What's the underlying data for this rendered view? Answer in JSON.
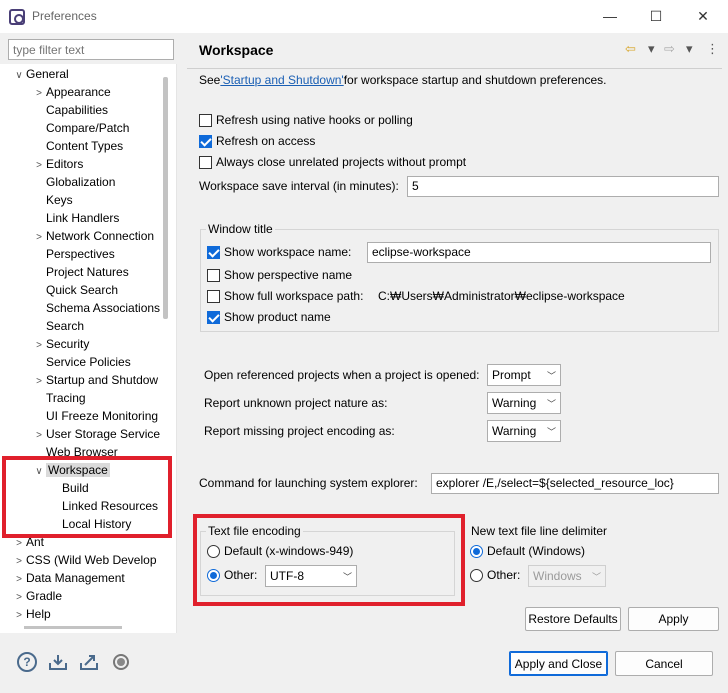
{
  "window": {
    "title": "Preferences",
    "minimize": "—",
    "maximize": "☐",
    "close": "✕"
  },
  "filter": {
    "placeholder": "type filter text"
  },
  "tree": [
    {
      "label": "General",
      "arrow": "∨"
    },
    {
      "label": "Appearance",
      "arrow": ">"
    },
    {
      "label": "Capabilities",
      "arrow": ""
    },
    {
      "label": "Compare/Patch",
      "arrow": ""
    },
    {
      "label": "Content Types",
      "arrow": ""
    },
    {
      "label": "Editors",
      "arrow": ">"
    },
    {
      "label": "Globalization",
      "arrow": ""
    },
    {
      "label": "Keys",
      "arrow": ""
    },
    {
      "label": "Link Handlers",
      "arrow": ""
    },
    {
      "label": "Network Connection",
      "arrow": ">"
    },
    {
      "label": "Perspectives",
      "arrow": ""
    },
    {
      "label": "Project Natures",
      "arrow": ""
    },
    {
      "label": "Quick Search",
      "arrow": ""
    },
    {
      "label": "Schema Associations",
      "arrow": ""
    },
    {
      "label": "Search",
      "arrow": ""
    },
    {
      "label": "Security",
      "arrow": ">"
    },
    {
      "label": "Service Policies",
      "arrow": ""
    },
    {
      "label": "Startup and Shutdow",
      "arrow": ">"
    },
    {
      "label": "Tracing",
      "arrow": ""
    },
    {
      "label": "UI Freeze Monitoring",
      "arrow": ""
    },
    {
      "label": "User Storage Service",
      "arrow": ">"
    },
    {
      "label": "Web Browser",
      "arrow": ""
    },
    {
      "label": "Workspace",
      "arrow": "∨"
    },
    {
      "label": "Build",
      "arrow": ""
    },
    {
      "label": "Linked Resources",
      "arrow": ""
    },
    {
      "label": "Local History",
      "arrow": ""
    },
    {
      "label": "Ant",
      "arrow": ">"
    },
    {
      "label": "CSS (Wild Web Develop",
      "arrow": ">"
    },
    {
      "label": "Data Management",
      "arrow": ">"
    },
    {
      "label": "Gradle",
      "arrow": ">"
    },
    {
      "label": "Help",
      "arrow": ">"
    }
  ],
  "page": {
    "title": "Workspace",
    "see_prefix": "See ",
    "see_link": "'Startup and Shutdown'",
    "see_suffix": " for workspace startup and shutdown preferences.",
    "nav_back": "⇦",
    "nav_fwd": "⇨",
    "menu": "⋮",
    "dropdown": "▾"
  },
  "options": {
    "refresh_native": {
      "label": "Refresh using native hooks or polling",
      "checked": false
    },
    "refresh_access": {
      "label": "Refresh on access",
      "checked": true
    },
    "always_close": {
      "label": "Always close unrelated projects without prompt",
      "checked": false
    },
    "save_interval_label": "Workspace save interval (in minutes):",
    "save_interval_value": "5"
  },
  "window_title": {
    "group_label": "Window title",
    "show_ws_name": {
      "label": "Show workspace name:",
      "checked": true
    },
    "ws_name_value": "eclipse-workspace",
    "show_perspective": {
      "label": "Show perspective name",
      "checked": false
    },
    "show_full_path": {
      "label": "Show full workspace path:",
      "checked": false
    },
    "full_path_value": "C:₩Users₩Administrator₩eclipse-workspace",
    "show_product": {
      "label": "Show product name",
      "checked": true
    }
  },
  "projects": {
    "open_referenced_label": "Open referenced projects when a project is opened:",
    "open_referenced_value": "Prompt",
    "unknown_nature_label": "Report unknown project nature as:",
    "unknown_nature_value": "Warning",
    "missing_encoding_label": "Report missing project encoding as:",
    "missing_encoding_value": "Warning"
  },
  "explorer": {
    "label": "Command for launching system explorer:",
    "value": "explorer /E,/select=${selected_resource_loc}"
  },
  "encoding": {
    "group_label": "Text file encoding",
    "default_label": "Default (x-windows-949)",
    "other_label": "Other:",
    "other_value": "UTF-8",
    "selected": "other"
  },
  "delimiter": {
    "group_label": "New text file line delimiter",
    "default_label": "Default (Windows)",
    "other_label": "Other:",
    "other_value": "Windows",
    "selected": "default"
  },
  "buttons": {
    "restore_defaults": "Restore Defaults",
    "apply": "Apply",
    "apply_close": "Apply and Close",
    "cancel": "Cancel"
  },
  "colors": {
    "accent": "#0f6ad9",
    "highlight": "#e0202c",
    "link": "#1a5fb4"
  }
}
